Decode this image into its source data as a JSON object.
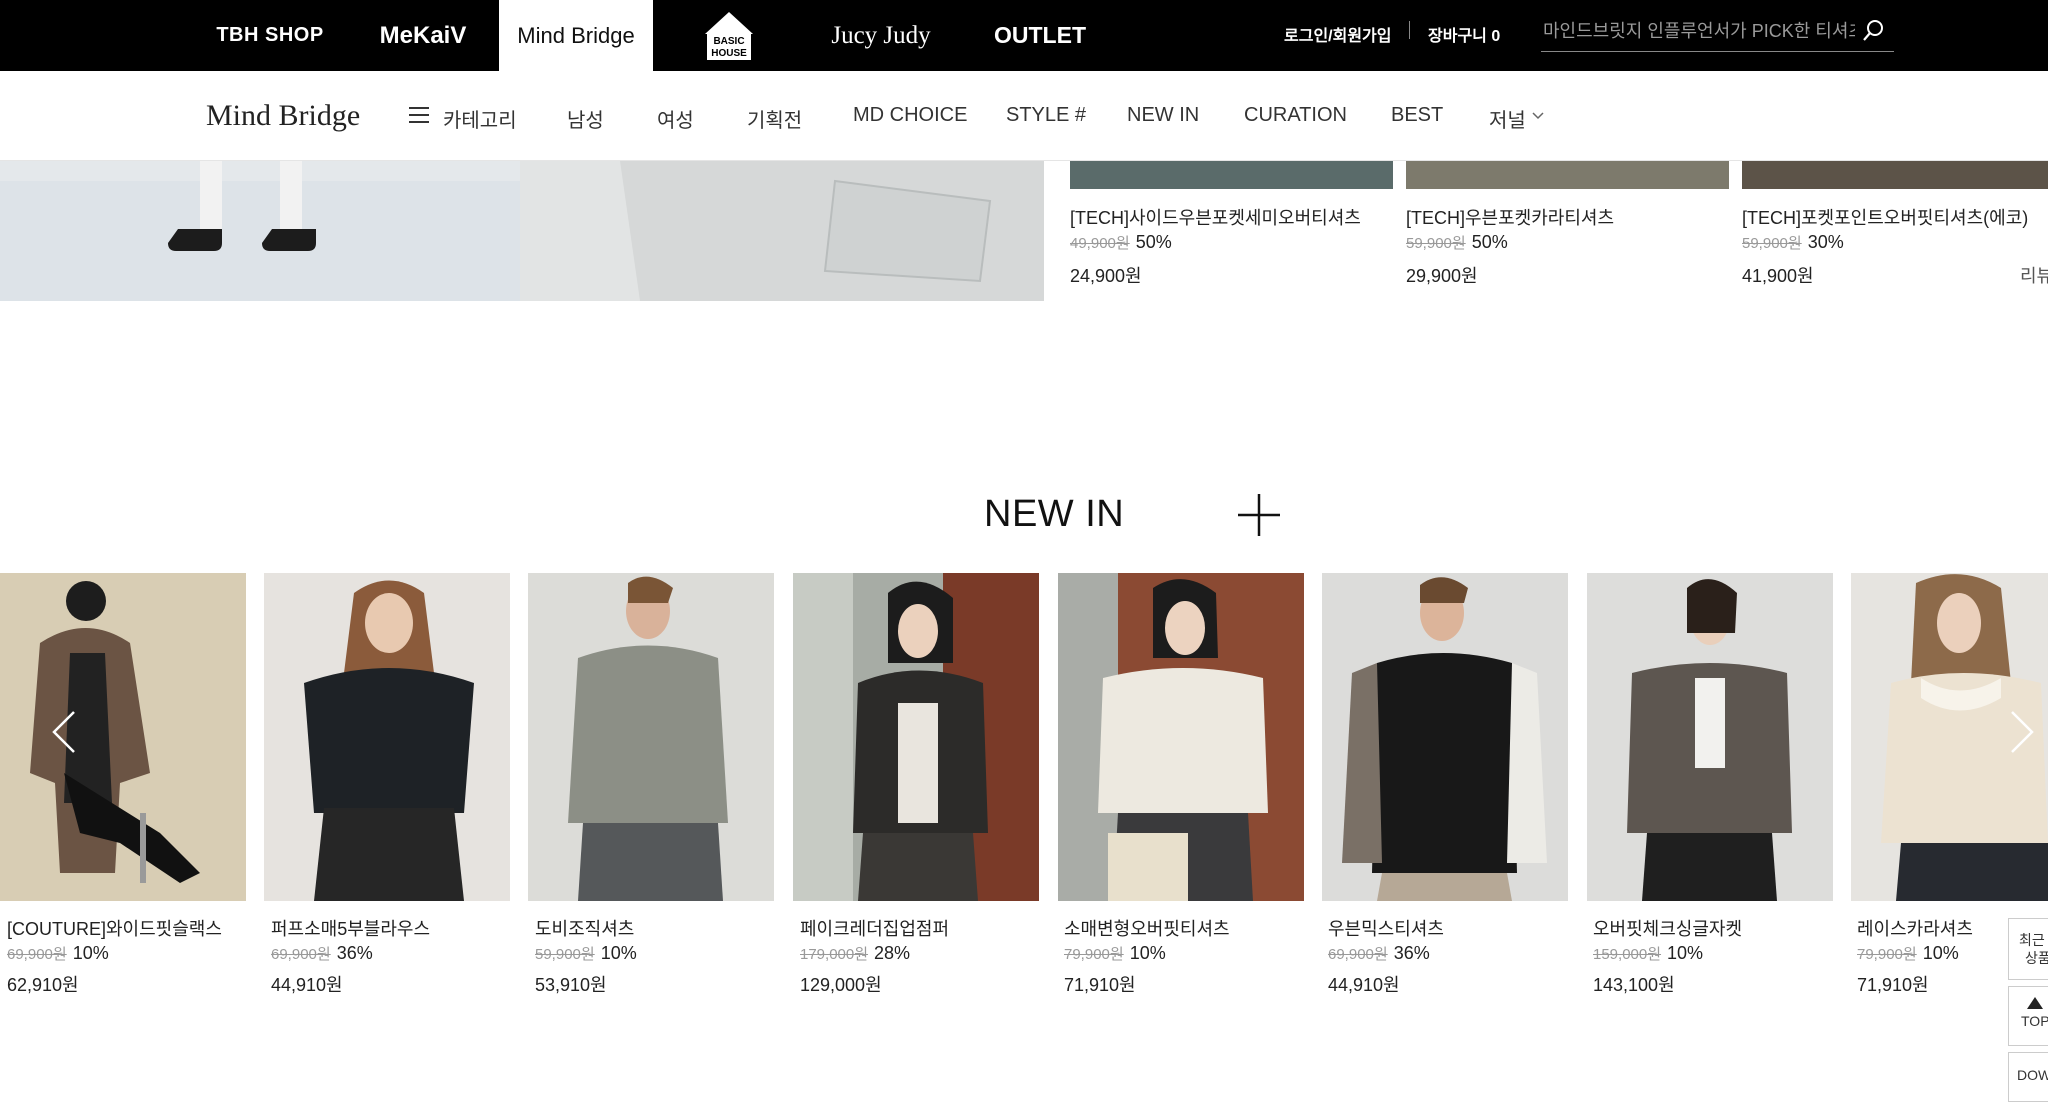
{
  "brands": {
    "tbh": "TBH SHOP",
    "mekaiv": "MeKaiV",
    "mindbridge": "Mind Bridge",
    "basichouse_line1": "BASIC",
    "basichouse_line2": "HOUSE",
    "jucyjudy": "Jucy Judy",
    "outlet": "OUTLET"
  },
  "util": {
    "login": "로그인/회원가입",
    "sep": "|",
    "cart": "장바구니 0"
  },
  "search": {
    "placeholder": "마인드브릿지 인플루언서가 PICK한 티셔츠"
  },
  "gnb": {
    "logo": "Mind Bridge",
    "category": "카테고리",
    "items": [
      "남성",
      "여성",
      "기획전",
      "MD CHOICE",
      "STYLE #",
      "NEW IN",
      "CURATION",
      "BEST",
      "저널"
    ]
  },
  "top_products": [
    {
      "name": "[TECH]사이드우븐포켓세미오버티셔츠",
      "orig": "49,900원",
      "disc": "50%",
      "price": "24,900원"
    },
    {
      "name": "[TECH]우븐포켓카라티셔츠",
      "orig": "59,900원",
      "disc": "50%",
      "price": "29,900원"
    },
    {
      "name": "[TECH]포켓포인트오버핏티셔츠(에코)",
      "orig": "59,900원",
      "disc": "30%",
      "price": "41,900원",
      "extra": "리뷰"
    }
  ],
  "new_in": {
    "title": "NEW IN",
    "products": [
      {
        "name": "[COUTURE]와이드핏슬랙스",
        "orig": "69,900원",
        "disc": "10%",
        "price": "62,910원"
      },
      {
        "name": "퍼프소매5부블라우스",
        "orig": "69,900원",
        "disc": "36%",
        "price": "44,910원"
      },
      {
        "name": "도비조직셔츠",
        "orig": "59,900원",
        "disc": "10%",
        "price": "53,910원"
      },
      {
        "name": "페이크레더집업점퍼",
        "orig": "179,000원",
        "disc": "28%",
        "price": "129,000원"
      },
      {
        "name": "소매변형오버핏티셔츠",
        "orig": "79,900원",
        "disc": "10%",
        "price": "71,910원"
      },
      {
        "name": "우븐믹스티셔츠",
        "orig": "69,900원",
        "disc": "36%",
        "price": "44,910원"
      },
      {
        "name": "오버핏체크싱글자켓",
        "orig": "159,000원",
        "disc": "10%",
        "price": "143,100원"
      },
      {
        "name": "레이스카라셔츠",
        "orig": "79,900원",
        "disc": "10%",
        "price": "71,910원"
      }
    ]
  },
  "side": {
    "recent_line1": "최근",
    "recent_line2": "상품",
    "top": "TOP",
    "down": "DOWN"
  }
}
